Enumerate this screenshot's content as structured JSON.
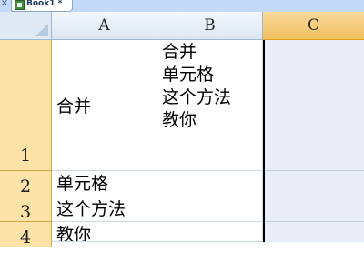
{
  "workbook_tab": {
    "title": "Book1 *"
  },
  "columns": [
    "A",
    "B",
    "C"
  ],
  "rows": [
    "1",
    "2",
    "3",
    "4"
  ],
  "cells": {
    "A1": "合并",
    "B1": [
      "合并",
      "单元格",
      "这个方法",
      "教你"
    ],
    "A2": "单元格",
    "A3": "这个方法",
    "A4": "教你"
  },
  "selection": {
    "column": "C"
  },
  "colors": {
    "selected_header": "#f1c15f",
    "row_header": "#fde3a7",
    "selected_fill": "#e8edf7"
  }
}
